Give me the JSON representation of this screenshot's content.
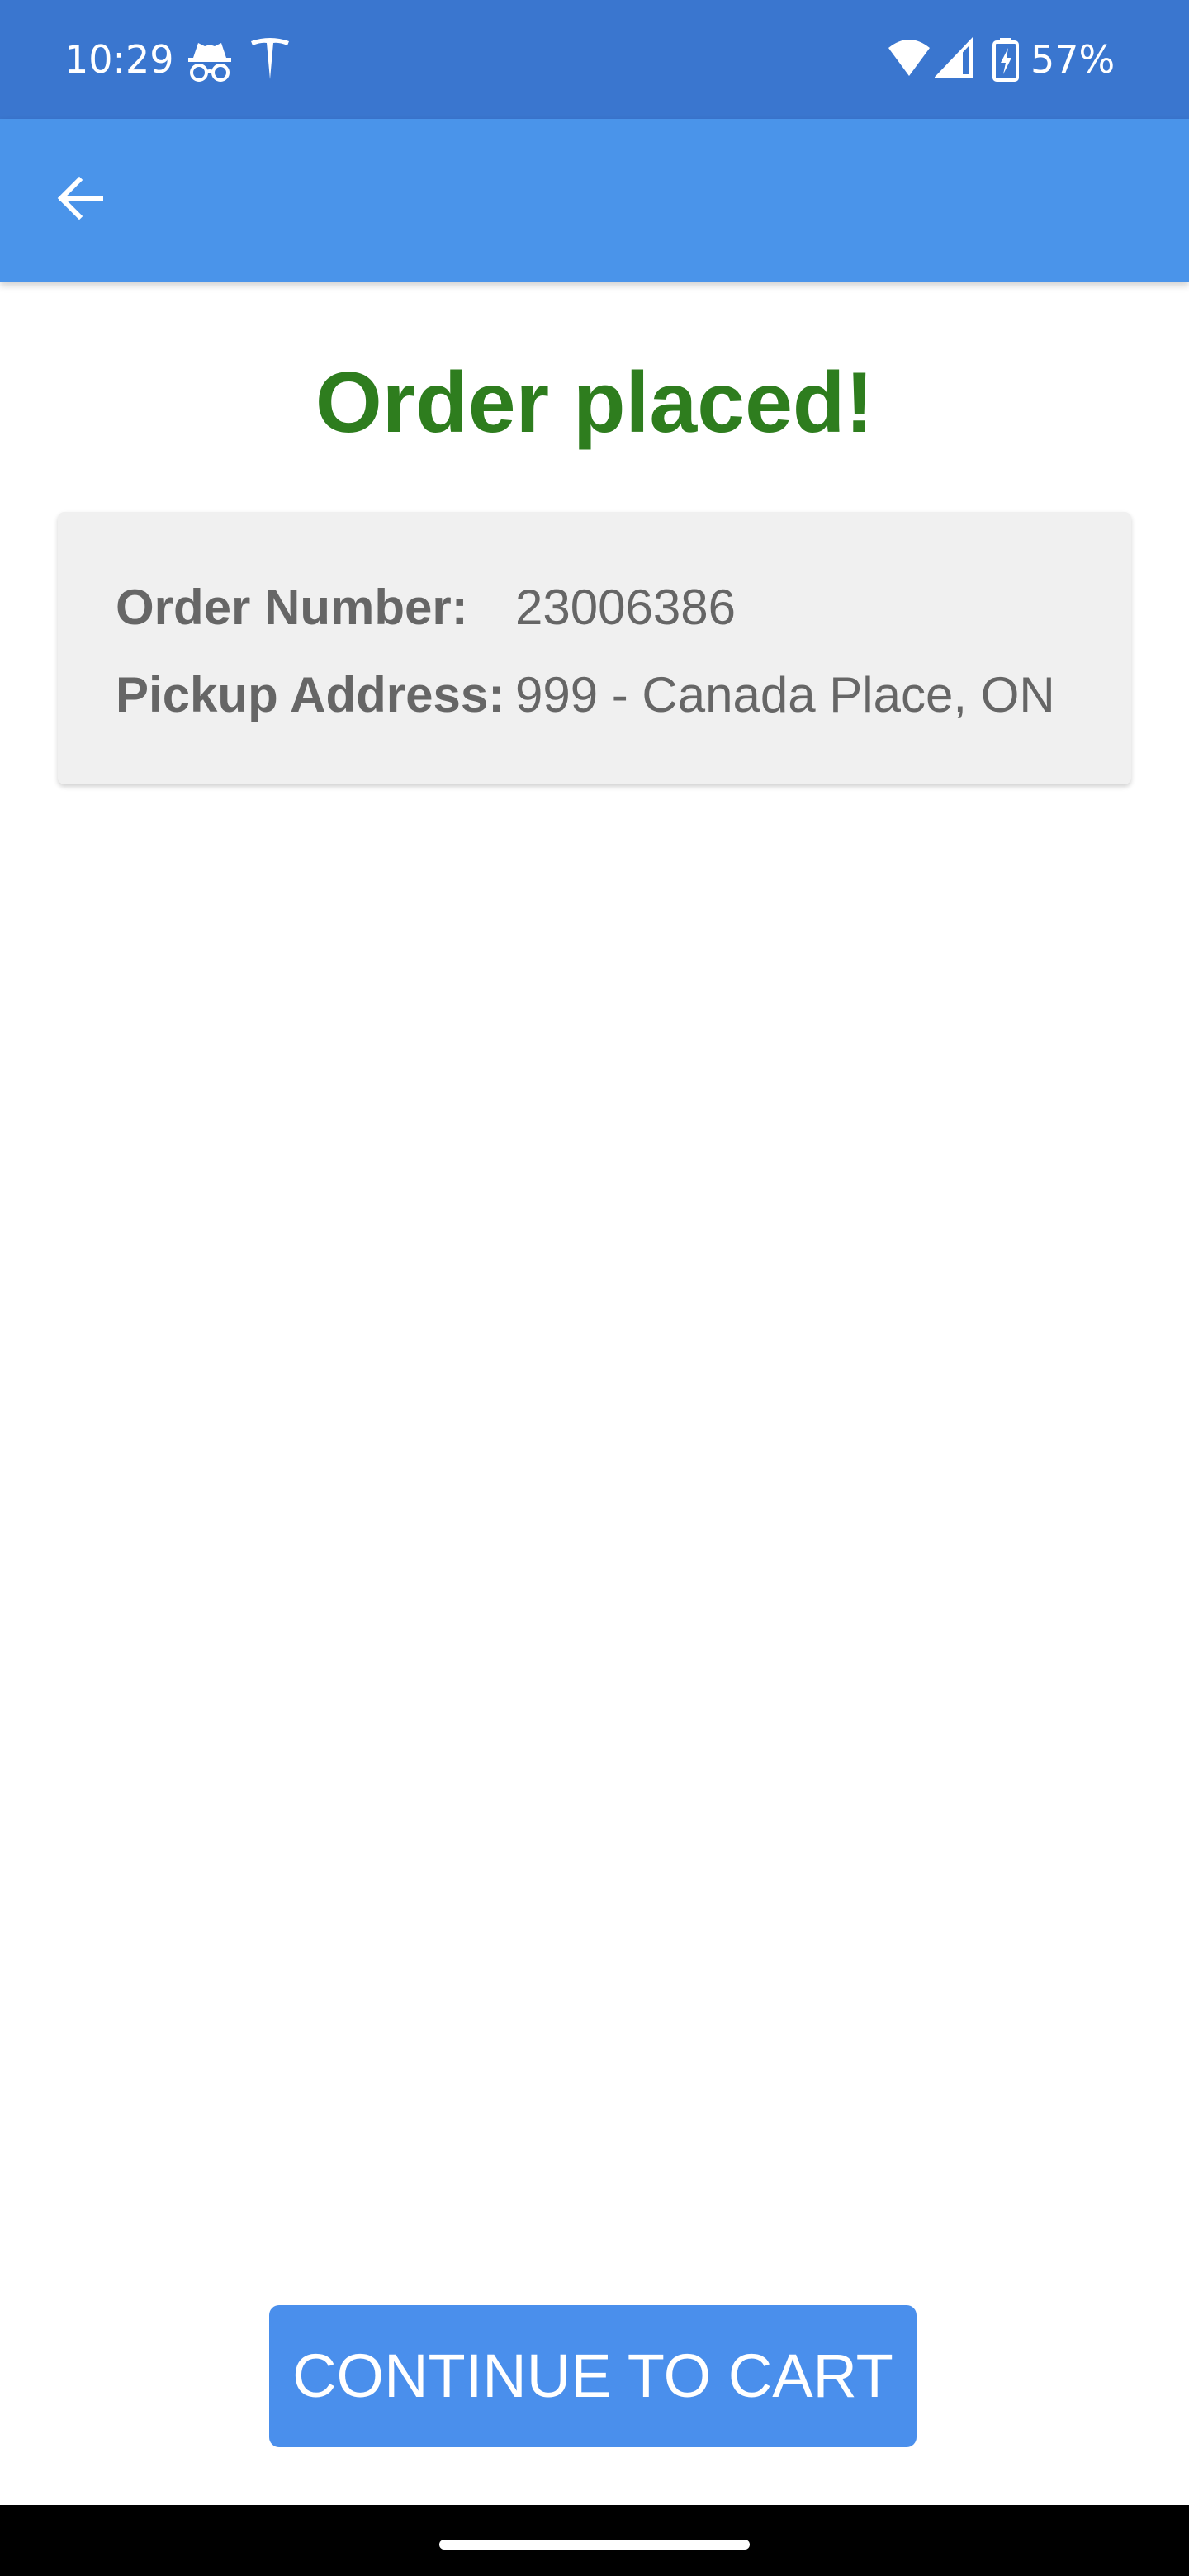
{
  "status_bar": {
    "time": "10:29",
    "battery_percent": "57%",
    "icons": [
      "incognito-icon",
      "tesla-icon",
      "wifi-icon",
      "signal-icon",
      "battery-charging-icon"
    ]
  },
  "app_bar": {
    "back_icon": "arrow-left-icon"
  },
  "main": {
    "title": "Order placed!",
    "order_number_label": "Order Number:",
    "order_number_value": "23006386",
    "pickup_address_label": "Pickup Address:",
    "pickup_address_value": "999 - Canada Place, ON"
  },
  "footer": {
    "continue_label": "CONTINUE TO CART"
  },
  "colors": {
    "status_bar": "#3a76cf",
    "app_bar": "#4a94ea",
    "title": "#2e7d1e",
    "card_bg": "#f0f0f0",
    "button": "#4a8fec"
  }
}
